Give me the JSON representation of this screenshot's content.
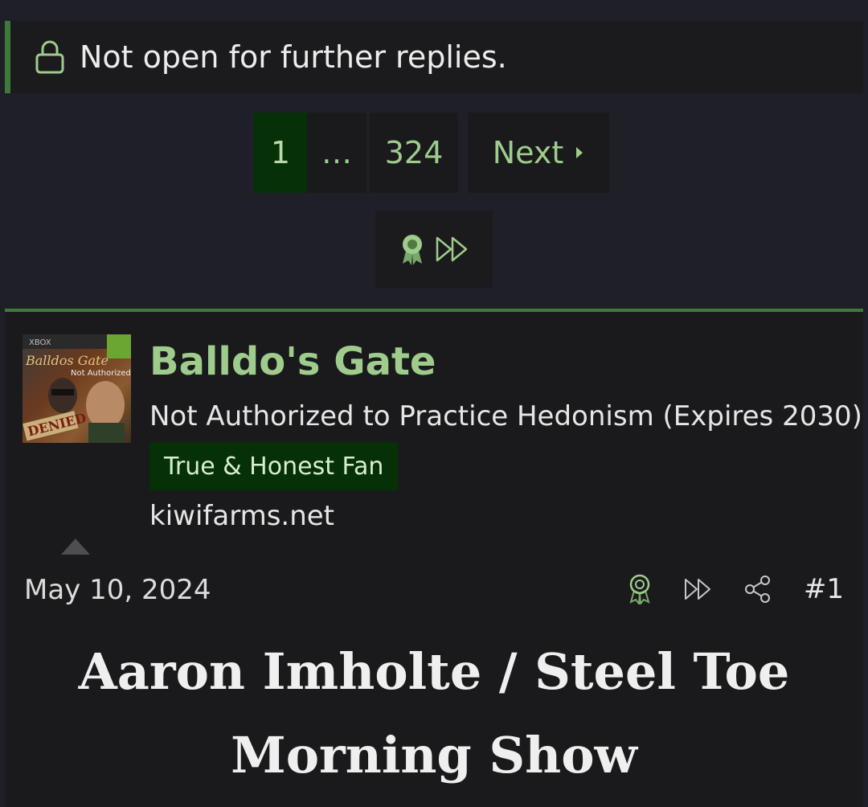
{
  "notice": {
    "text": "Not open for further replies.",
    "icon": "lock-icon"
  },
  "pagination": {
    "pages": [
      "1",
      "…",
      "324"
    ],
    "current": "1",
    "next_label": "Next",
    "icons": [
      "ribbon-award-icon",
      "fast-forward-icon"
    ]
  },
  "post": {
    "avatar_text": {
      "brand": "XBOX",
      "title": "Balldos Gate",
      "sub": "Not Authorized",
      "stamp": "DENIED"
    },
    "username": "Balldo's Gate",
    "user_title": "Not Authorized to Practice Hedonism (Expires 2030)",
    "banner": "True & Honest Fan",
    "site": "kiwifarms.net",
    "date": "May 10, 2024",
    "post_number": "#1",
    "action_icons": [
      "ribbon-award-icon",
      "fast-forward-icon",
      "share-icon"
    ],
    "title_line1": "Aaron Imholte / Steel Toe",
    "title_line2": "Morning Show"
  },
  "colors": {
    "accent": "#9fcc8c",
    "highlight": "#063005",
    "border": "#3f7a3a",
    "background": "#1f2027"
  }
}
